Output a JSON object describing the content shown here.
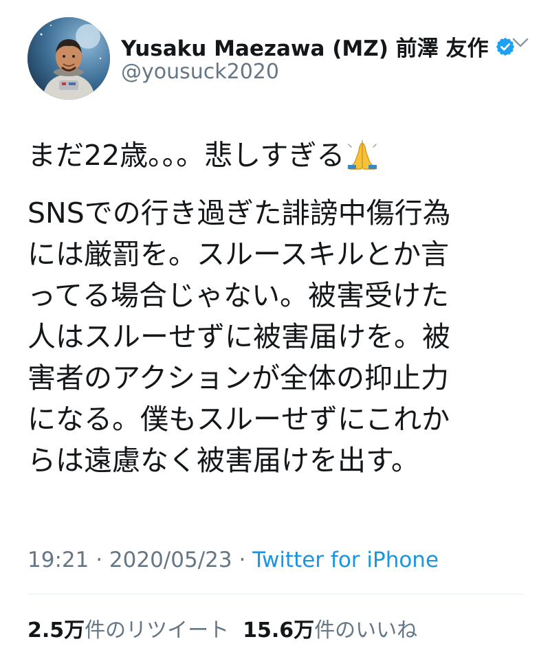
{
  "author": {
    "display_name": "Yusaku Maezawa (MZ) 前澤 友作",
    "handle": "@yousuck2020",
    "verified": true
  },
  "tweet": {
    "line1": "まだ22歳。。。悲しすぎる",
    "emoji": "folded-hands",
    "paragraph2_lines": [
      "SNSでの行き過ぎた誹謗中傷行為",
      "には厳罰を。スルースキルとか言",
      "ってる場合じゃない。被害受けた",
      "人はスルーせずに被害届けを。被",
      "害者のアクションが全体の抑止力",
      "になる。僕もスルーせずにこれか",
      "らは遠慮なく被害届けを出す。"
    ]
  },
  "meta": {
    "time": "19:21",
    "separator": " · ",
    "date": "2020/05/23",
    "source": "Twitter for iPhone"
  },
  "stats": {
    "retweets_count": "2.5万",
    "retweets_label": "件のリツイート",
    "likes_count": "15.6万",
    "likes_label": "件のいいね"
  },
  "colors": {
    "text": "#14171a",
    "secondary": "#657786",
    "link": "#1b95e0",
    "verified": "#1da1f2",
    "divider": "#e6ecf0"
  }
}
